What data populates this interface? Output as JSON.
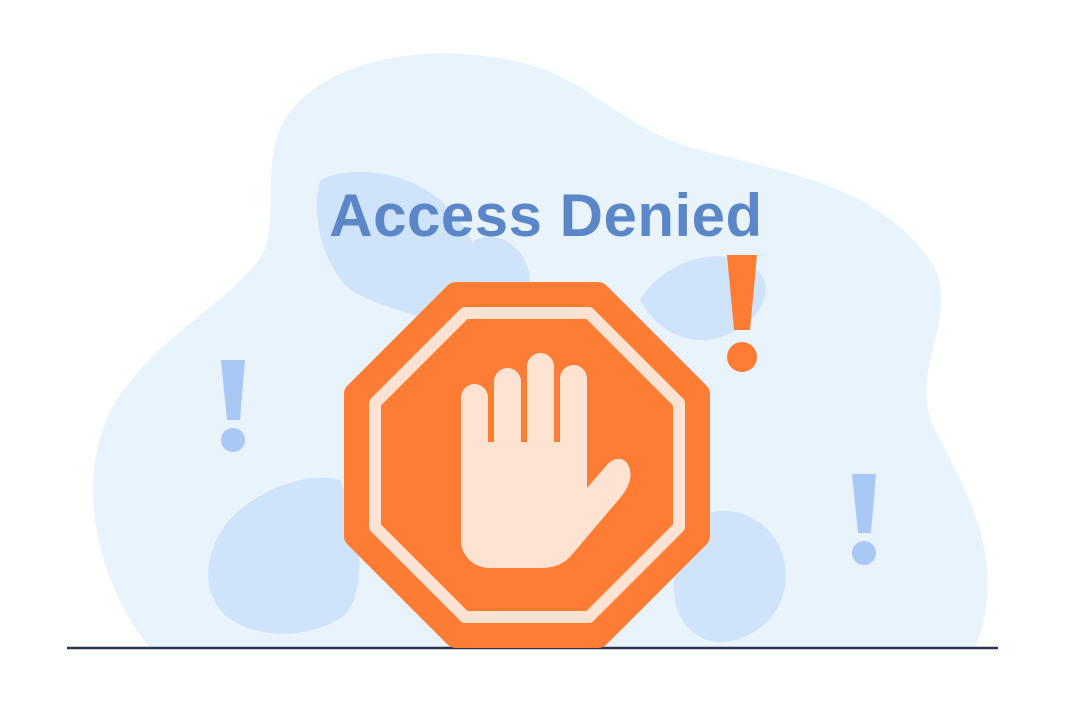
{
  "headline": "Access Denied",
  "colors": {
    "blob": "#e9f3fc",
    "leaf": "#cfe3fb",
    "headline": "#5b86c8",
    "sign": "#fe7c34",
    "sign_ring": "#fee3d2",
    "hand": "#fee3d2",
    "exclamation_orange": "#fe7c34",
    "exclamation_blue": "#aac8f6",
    "ground_line": "#2c3550"
  },
  "icons": {
    "sign": "stop-sign-icon",
    "hand": "raised-hand-icon",
    "alert_marks": "exclamation-mark-icon"
  }
}
